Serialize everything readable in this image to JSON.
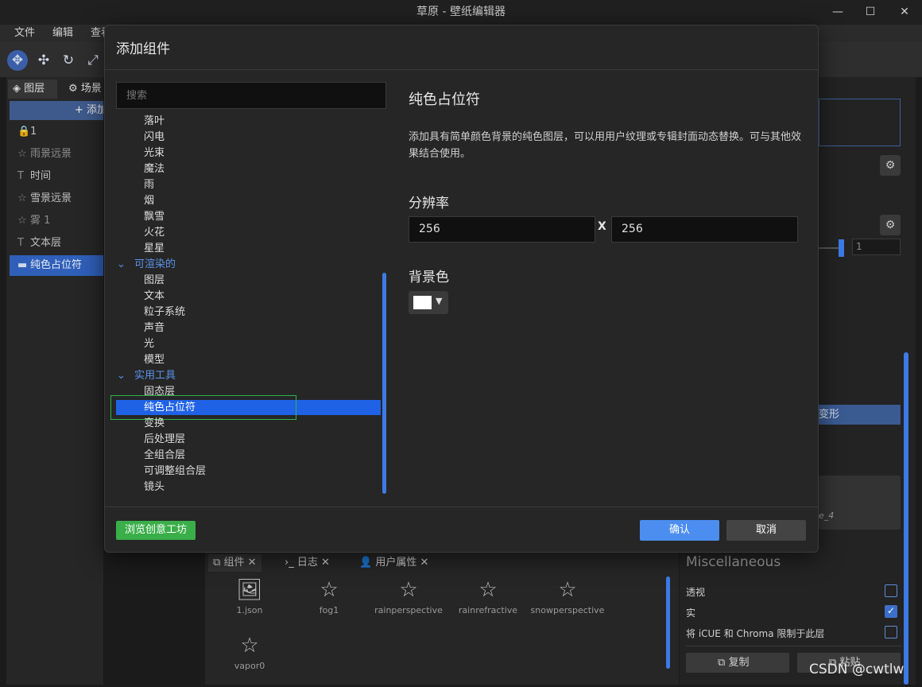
{
  "window": {
    "title": "草原 - 壁纸编辑器"
  },
  "menubar": [
    "文件",
    "编辑",
    "查看"
  ],
  "left_panel": {
    "tabs": [
      "图层",
      "场景"
    ],
    "add_button": "+ 添加",
    "layers": [
      {
        "label": "1",
        "icon": "lock-icon"
      },
      {
        "label": "雨景远景",
        "icon": "star-icon"
      },
      {
        "label": "时间",
        "icon": "text-icon"
      },
      {
        "label": "雪景远景",
        "icon": "star-icon"
      },
      {
        "label": "雾 1",
        "icon": "star-icon"
      },
      {
        "label": "文本层",
        "icon": "text-icon"
      },
      {
        "label": "纯色占位符",
        "icon": "rectangle-icon"
      }
    ]
  },
  "right_panel": {
    "field_value": "1",
    "button_partial": "变形",
    "thumb_label_partial": "e_4",
    "section_title": "Miscellaneous",
    "options": [
      {
        "label": "透视",
        "checked": false
      },
      {
        "label": "实",
        "checked": true
      },
      {
        "label": "将 iCUE 和 Chroma 限制于此层",
        "checked": false
      }
    ],
    "copy_button": "复制",
    "paste_button": "粘贴"
  },
  "bottom_panel": {
    "tabs": [
      "组件",
      "日志",
      "用户属性"
    ],
    "assets": [
      "1.json",
      "fog1",
      "rainperspective",
      "rainrefractive",
      "snowperspective",
      "vapor0"
    ]
  },
  "dialog": {
    "title": "添加组件",
    "search_placeholder": "搜索",
    "tree_items_top": [
      "落叶",
      "闪电",
      "光束",
      "魔法",
      "雨",
      "烟",
      "飘雪",
      "火花",
      "星星"
    ],
    "category_renderable": "可渲染的",
    "renderable_items": [
      "图层",
      "文本",
      "粒子系统",
      "声音",
      "光",
      "模型"
    ],
    "category_utility": "实用工具",
    "utility_items": [
      "固态层",
      "纯色占位符",
      "变换",
      "后处理层",
      "全组合层",
      "可调整组合层",
      "镜头"
    ],
    "selected_item": "纯色占位符",
    "detail": {
      "title": "纯色占位符",
      "description": "添加具有简单颜色背景的纯色图层，可以用用户纹理或专辑封面动态替换。可与其他效果结合使用。",
      "resolution_label": "分辨率",
      "width": "256",
      "separator": "X",
      "height": "256",
      "background_label": "背景色",
      "background_color": "#ffffff"
    },
    "workshop_button": "浏览创意工坊",
    "ok_button": "确认",
    "cancel_button": "取消"
  },
  "watermark": "CSDN @cwtlw",
  "colors": {
    "accent": "#1f62e6",
    "highlight_outline": "#2fb34a",
    "workshop_green": "#3aae49",
    "ok_blue": "#4c8eef"
  }
}
